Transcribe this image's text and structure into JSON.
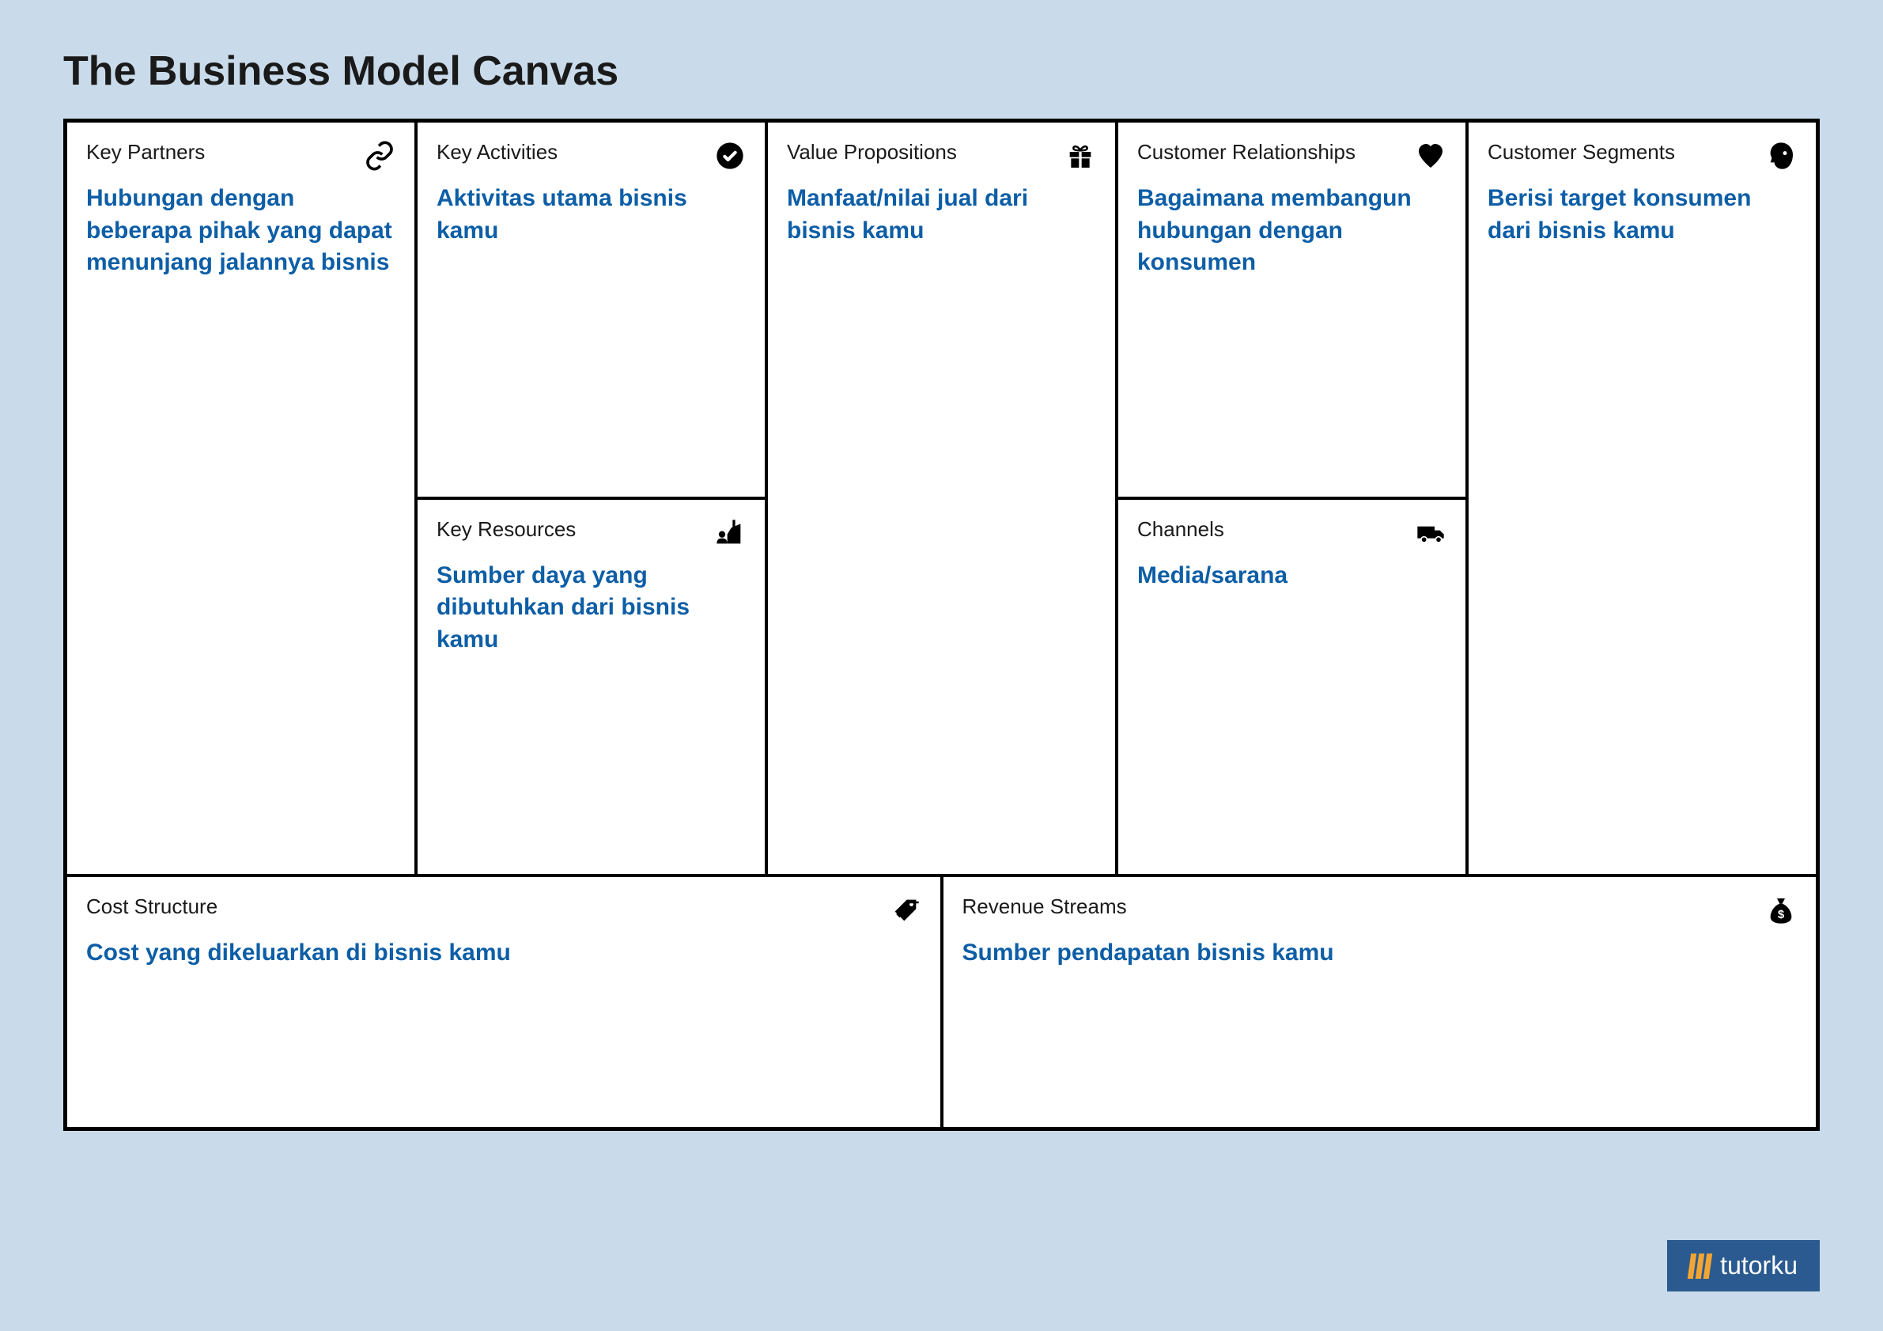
{
  "title": "The Business Model Canvas",
  "cells": {
    "key_partners": {
      "label": "Key Partners",
      "content": "Hubungan dengan beberapa pihak yang dapat menunjang jalannya bisnis"
    },
    "key_activities": {
      "label": "Key Activities",
      "content": "Aktivitas utama bisnis kamu"
    },
    "key_resources": {
      "label": "Key Resources",
      "content": "Sumber daya yang dibutuhkan dari bisnis kamu"
    },
    "value_propositions": {
      "label": "Value Propositions",
      "content": "Manfaat/nilai jual dari bisnis kamu"
    },
    "customer_relationships": {
      "label": "Customer Relationships",
      "content": "Bagaimana membangun hubungan dengan konsumen"
    },
    "channels": {
      "label": "Channels",
      "content": "Media/sarana"
    },
    "customer_segments": {
      "label": "Customer Segments",
      "content": "Berisi target konsumen dari bisnis kamu"
    },
    "cost_structure": {
      "label": "Cost Structure",
      "content": "Cost yang dikeluarkan di bisnis kamu"
    },
    "revenue_streams": {
      "label": "Revenue Streams",
      "content": "Sumber pendapatan bisnis kamu"
    }
  },
  "brand": "tutorku"
}
